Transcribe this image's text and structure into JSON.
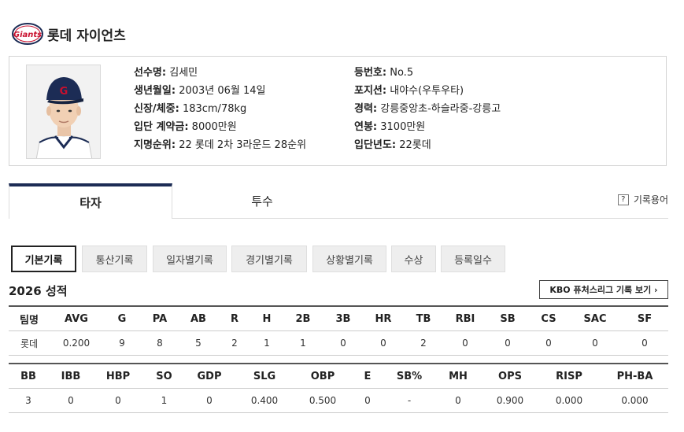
{
  "team": {
    "name": "롯데 자이언츠",
    "logo_text": "Giants",
    "logo_color": "#c8102e"
  },
  "player": {
    "fields_left": [
      {
        "label": "선수명:",
        "value": "김세민"
      },
      {
        "label": "생년월일:",
        "value": "2003년 06월 14일"
      },
      {
        "label": "신장/체중:",
        "value": "183cm/78kg"
      },
      {
        "label": "입단 계약금:",
        "value": "8000만원"
      },
      {
        "label": "지명순위:",
        "value": "22 롯데 2차 3라운드 28순위"
      }
    ],
    "fields_right": [
      {
        "label": "등번호:",
        "value": "No.5"
      },
      {
        "label": "포지션:",
        "value": "내야수(우투우타)"
      },
      {
        "label": "경력:",
        "value": "강릉중앙초-하슬라중-강릉고"
      },
      {
        "label": "연봉:",
        "value": "3100만원"
      },
      {
        "label": "입단년도:",
        "value": "22롯데"
      }
    ]
  },
  "tabs": {
    "batter": "타자",
    "pitcher": "투수",
    "term_icon": "?",
    "term_label": "기록용어"
  },
  "subtabs": [
    "기본기록",
    "통산기록",
    "일자별기록",
    "경기별기록",
    "상황별기록",
    "수상",
    "등록일수"
  ],
  "season": {
    "title": "2026 성적",
    "futures_button": "KBO 퓨처스리그 기록 보기 ›"
  },
  "stats_table_1": {
    "headers": [
      "팀명",
      "AVG",
      "G",
      "PA",
      "AB",
      "R",
      "H",
      "2B",
      "3B",
      "HR",
      "TB",
      "RBI",
      "SB",
      "CS",
      "SAC",
      "SF"
    ],
    "row": [
      "롯데",
      "0.200",
      "9",
      "8",
      "5",
      "2",
      "1",
      "1",
      "0",
      "0",
      "2",
      "0",
      "0",
      "0",
      "0",
      "0"
    ]
  },
  "stats_table_2": {
    "headers": [
      "BB",
      "IBB",
      "HBP",
      "SO",
      "GDP",
      "SLG",
      "OBP",
      "E",
      "SB%",
      "MH",
      "OPS",
      "RISP",
      "PH-BA"
    ],
    "row": [
      "3",
      "0",
      "0",
      "1",
      "0",
      "0.400",
      "0.500",
      "0",
      "-",
      "0",
      "0.900",
      "0.000",
      "0.000"
    ]
  },
  "colors": {
    "tab_accent": "#1c2c55",
    "subtab_bg": "#eeeeee"
  }
}
